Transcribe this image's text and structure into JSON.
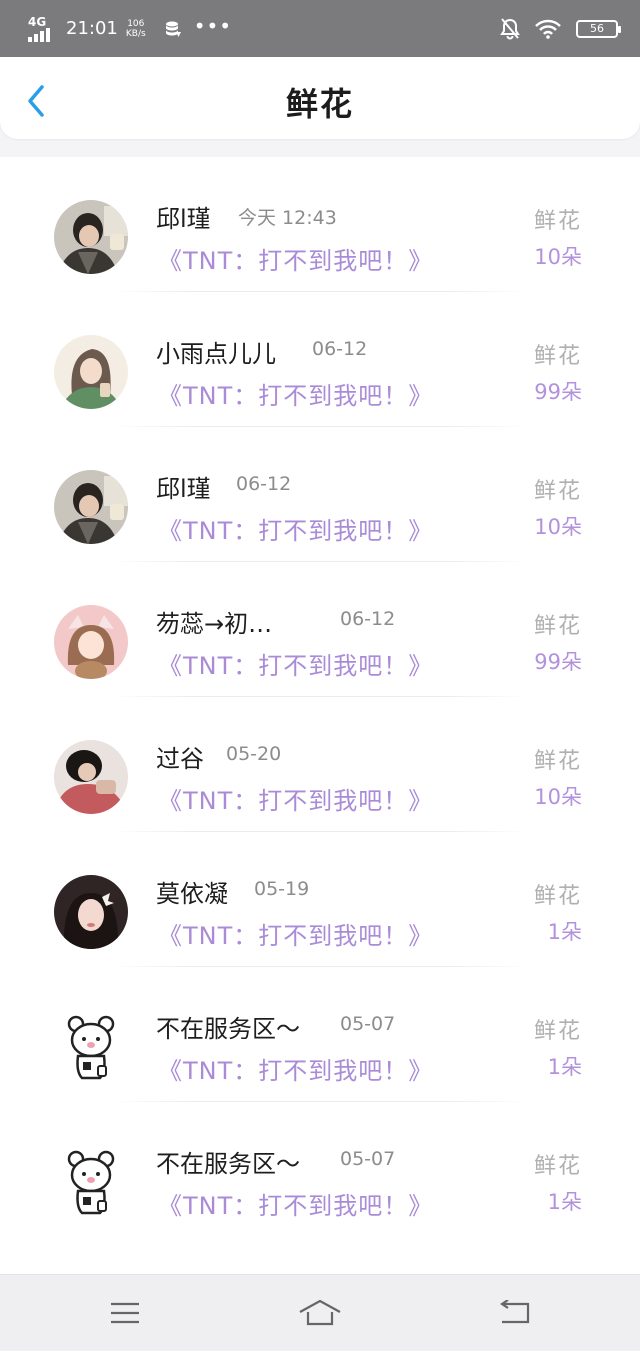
{
  "status_bar": {
    "network": "4G",
    "time": "21:01",
    "speed_value": "106",
    "speed_unit": "KB/s",
    "more": "•••",
    "battery": "56"
  },
  "header": {
    "title": "鲜花",
    "back_icon": "chevron-left-icon"
  },
  "records": [
    {
      "name": "邱l瑾",
      "date": "今天 12:43",
      "gift": "《TNT：打不到我吧！》",
      "label": "鲜花",
      "count": "10朵"
    },
    {
      "name": "小雨点儿儿",
      "date": "06-12",
      "gift": "《TNT：打不到我吧！》",
      "label": "鲜花",
      "count": "99朵"
    },
    {
      "name": "邱l瑾",
      "date": "06-12",
      "gift": "《TNT：打不到我吧！》",
      "label": "鲜花",
      "count": "10朵"
    },
    {
      "name": "芴蕊→初…",
      "date": "06-12",
      "gift": "《TNT：打不到我吧！》",
      "label": "鲜花",
      "count": "99朵"
    },
    {
      "name": "过谷",
      "date": "05-20",
      "gift": "《TNT：打不到我吧！》",
      "label": "鲜花",
      "count": "10朵"
    },
    {
      "name": "莫依凝",
      "date": "05-19",
      "gift": "《TNT：打不到我吧！》",
      "label": "鲜花",
      "count": "1朵"
    },
    {
      "name": "不在服务区～",
      "date": "05-07",
      "gift": "《TNT：打不到我吧！》",
      "label": "鲜花",
      "count": "1朵"
    },
    {
      "name": "不在服务区～",
      "date": "05-07",
      "gift": "《TNT：打不到我吧！》",
      "label": "鲜花",
      "count": "1朵"
    }
  ],
  "nav": {
    "menu_icon": "menu-icon",
    "home_icon": "home-icon",
    "back_icon": "back-arrow-icon"
  },
  "colors": {
    "accent_blue": "#2a9fe8",
    "gift_purple": "#a98bd8",
    "status_bar": "#7b7b7d"
  }
}
